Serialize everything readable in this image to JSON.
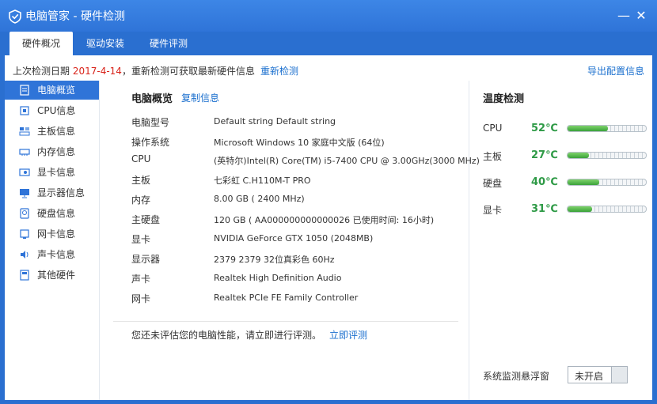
{
  "window": {
    "title": "电脑管家 - 硬件检测",
    "minimize": "—",
    "close": "✕"
  },
  "tabs": [
    {
      "label": "硬件概况"
    },
    {
      "label": "驱动安装"
    },
    {
      "label": "硬件评测"
    }
  ],
  "topbar": {
    "prefix": "上次检测日期 ",
    "date": "2017-4-14",
    "suffix": "，重新检测可获取最新硬件信息",
    "recheck": "重新检测",
    "export": "导出配置信息"
  },
  "sidebar": {
    "items": [
      {
        "label": "电脑概览",
        "icon": "overview-icon"
      },
      {
        "label": "CPU信息",
        "icon": "cpu-icon"
      },
      {
        "label": "主板信息",
        "icon": "motherboard-icon"
      },
      {
        "label": "内存信息",
        "icon": "memory-icon"
      },
      {
        "label": "显卡信息",
        "icon": "gpu-icon"
      },
      {
        "label": "显示器信息",
        "icon": "monitor-icon"
      },
      {
        "label": "硬盘信息",
        "icon": "disk-icon"
      },
      {
        "label": "网卡信息",
        "icon": "network-icon"
      },
      {
        "label": "声卡信息",
        "icon": "sound-icon"
      },
      {
        "label": "其他硬件",
        "icon": "other-icon"
      }
    ]
  },
  "main": {
    "title": "电脑概览",
    "copy": "复制信息",
    "rows": [
      {
        "k": "电脑型号",
        "v": "Default string Default string"
      },
      {
        "k": "操作系统",
        "v": "Microsoft Windows 10 家庭中文版 (64位)"
      },
      {
        "k": "CPU",
        "v": "(英特尔)Intel(R) Core(TM) i5-7400 CPU @ 3.00GHz(3000 MHz)"
      },
      {
        "k": "主板",
        "v": "七彩虹 C.H110M-T PRO"
      },
      {
        "k": "内存",
        "v": "8.00 GB (   2400 MHz)"
      },
      {
        "k": "主硬盘",
        "v": "120 GB ( AA000000000000026 已使用时间: 16小时)"
      },
      {
        "k": "显卡",
        "v": "NVIDIA GeForce GTX 1050 (2048MB)"
      },
      {
        "k": "显示器",
        "v": "2379 2379 32位真彩色 60Hz"
      },
      {
        "k": "声卡",
        "v": "Realtek High Definition Audio"
      },
      {
        "k": "网卡",
        "v": "Realtek PCIe FE Family Controller"
      }
    ],
    "hint": "您还未评估您的电脑性能，请立即进行评测。",
    "hint_link": "立即评测"
  },
  "temperature": {
    "title": "温度检测",
    "items": [
      {
        "name": "CPU",
        "value": "52℃",
        "level": 0.52
      },
      {
        "name": "主板",
        "value": "27℃",
        "level": 0.27
      },
      {
        "name": "硬盘",
        "value": "40℃",
        "level": 0.4
      },
      {
        "name": "显卡",
        "value": "31℃",
        "level": 0.31
      }
    ],
    "float_label": "系统监测悬浮窗",
    "toggle_label": "未开启"
  }
}
